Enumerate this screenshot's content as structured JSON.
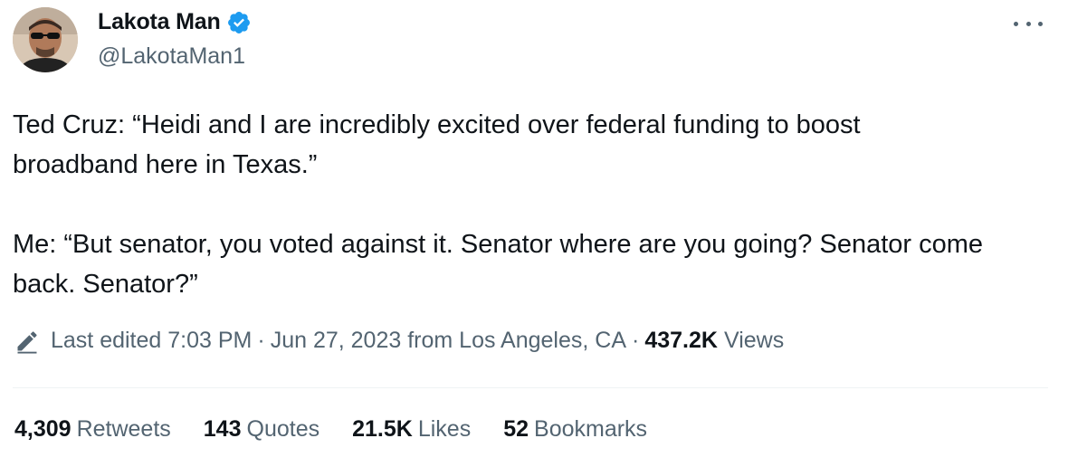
{
  "author": {
    "display_name": "Lakota Man",
    "handle": "@LakotaMan1",
    "verified_icon": "verified-badge-icon"
  },
  "tweet": {
    "text": "Ted Cruz: “Heidi and I are incredibly excited over federal funding to boost\nbroadband here in Texas.”\n\nMe: “But senator, you voted against it. Senator where are you going? Senator come\nback. Senator?”"
  },
  "meta": {
    "edited_label": "Last edited 7:03 PM",
    "sep1": "·",
    "date": "Jun 27, 2023 from Los Angeles, CA",
    "sep2": "·",
    "views_count": "437.2K",
    "views_label": "Views"
  },
  "stats": {
    "retweets": {
      "count": "4,309",
      "label": "Retweets"
    },
    "quotes": {
      "count": "143",
      "label": "Quotes"
    },
    "likes": {
      "count": "21.5K",
      "label": "Likes"
    },
    "bookmarks": {
      "count": "52",
      "label": "Bookmarks"
    }
  },
  "colors": {
    "verified": "#1d9bf0",
    "secondary_text": "#536471",
    "primary_text": "#0f1419"
  }
}
